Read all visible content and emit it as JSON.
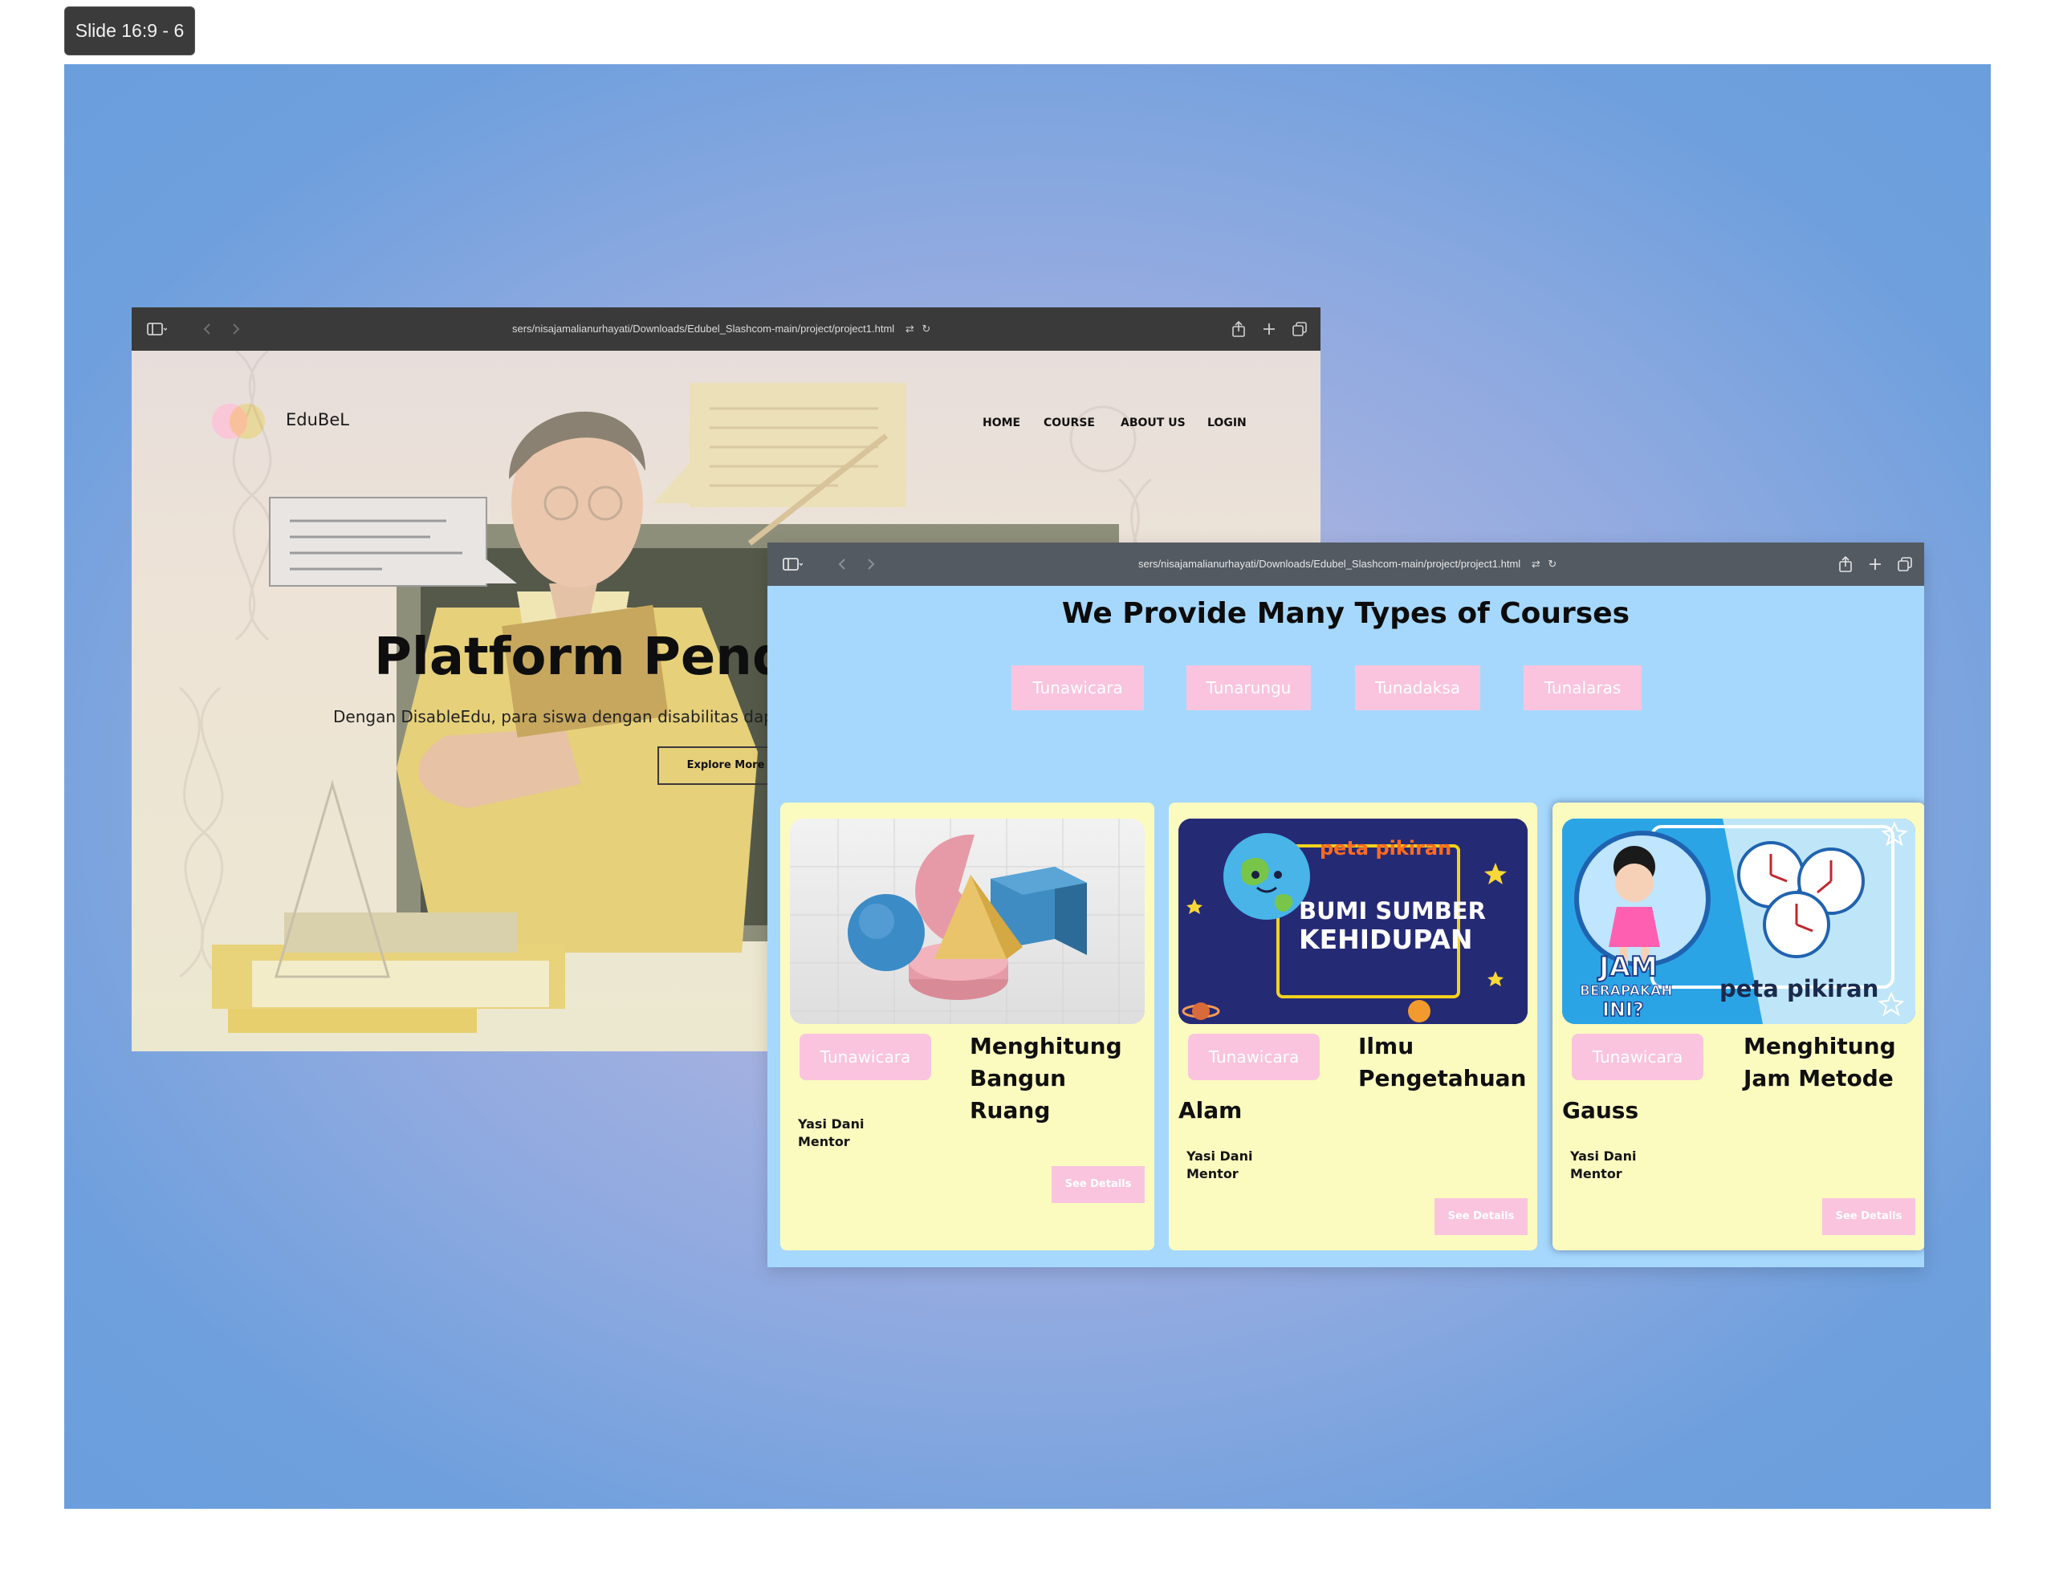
{
  "slide": {
    "label": "Slide 16:9 - 6"
  },
  "window_back": {
    "url": "sers/nisajamalianurhayati/Downloads/Edubel_Slashcom-main/project/project1.html",
    "logo_text": "EduBeL",
    "nav": [
      "HOME",
      "COURSE",
      "ABOUT US",
      "LOGIN"
    ],
    "hero_title": "Platform Pendid",
    "hero_subtitle": "Dengan DisableEdu, para siswa dengan disabilitas dapat",
    "explore_label": "Explore More"
  },
  "window_front": {
    "url": "sers/nisajamalianurhayati/Downloads/Edubel_Slashcom-main/project/project1.html",
    "section_title": "We Provide Many Types of Courses",
    "categories": [
      "Tunawicara",
      "Tunarungu",
      "Tunadaksa",
      "Tunalaras"
    ],
    "cards": [
      {
        "tag": "Tunawicara",
        "title_line1": "Menghitung",
        "title_line2": "Bangun Ruang",
        "title_line3": "",
        "mentor_name": "Yasi Dani",
        "mentor_role": "Mentor",
        "details_label": "See Details"
      },
      {
        "tag": "Tunawicara",
        "title_line1": "Ilmu",
        "title_line2": "Pengetahuan",
        "title_line3": "Alam",
        "mentor_name": "Yasi Dani",
        "mentor_role": "Mentor",
        "details_label": "See Details",
        "thumb_brand": "peta pikiran",
        "thumb_text_1": "BUMI SUMBER",
        "thumb_text_2": "KEHIDUPAN"
      },
      {
        "tag": "Tunawicara",
        "title_line1": "Menghitung",
        "title_line2": "Jam Metode",
        "title_line3": "Gauss",
        "mentor_name": "Yasi Dani",
        "mentor_role": "Mentor",
        "details_label": "See Details",
        "thumb_brand": "peta pikiran",
        "thumb_text_1": "JAM",
        "thumb_text_2": "BERAPAKAH",
        "thumb_text_3": "INI?"
      }
    ]
  },
  "colors": {
    "accent_pink": "#fac4de",
    "card_yellow": "#fbfbc0",
    "section_blue": "#a6d8fd",
    "artboard_blue": "#6a9edd"
  }
}
